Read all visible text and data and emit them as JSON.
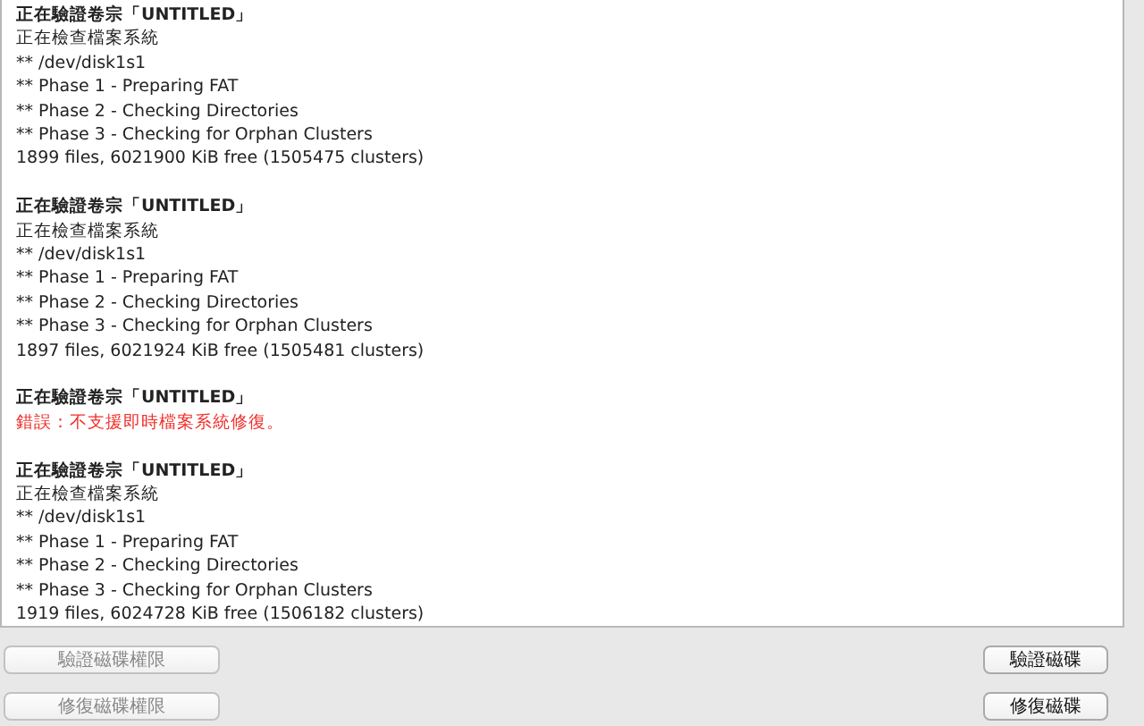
{
  "log": [
    {
      "lines": [
        {
          "kind": "heading",
          "text": "正在驗證卷宗「UNTITLED」"
        },
        {
          "kind": "normal",
          "text": "正在檢查檔案系統"
        },
        {
          "kind": "normal",
          "text": "** /dev/disk1s1"
        },
        {
          "kind": "normal",
          "text": "** Phase 1 - Preparing FAT"
        },
        {
          "kind": "normal",
          "text": "** Phase 2 - Checking Directories"
        },
        {
          "kind": "normal",
          "text": "** Phase 3 - Checking for Orphan Clusters"
        },
        {
          "kind": "normal",
          "text": "1899 files, 6021900 KiB free (1505475 clusters)"
        }
      ]
    },
    {
      "lines": [
        {
          "kind": "heading",
          "text": "正在驗證卷宗「UNTITLED」"
        },
        {
          "kind": "normal",
          "text": "正在檢查檔案系統"
        },
        {
          "kind": "normal",
          "text": "** /dev/disk1s1"
        },
        {
          "kind": "normal",
          "text": "** Phase 1 - Preparing FAT"
        },
        {
          "kind": "normal",
          "text": "** Phase 2 - Checking Directories"
        },
        {
          "kind": "normal",
          "text": "** Phase 3 - Checking for Orphan Clusters"
        },
        {
          "kind": "normal",
          "text": "1897 files, 6021924 KiB free (1505481 clusters)"
        }
      ]
    },
    {
      "lines": [
        {
          "kind": "heading",
          "text": "正在驗證卷宗「UNTITLED」"
        },
        {
          "kind": "error",
          "text": "錯誤：不支援即時檔案系統修復。"
        }
      ]
    },
    {
      "lines": [
        {
          "kind": "heading",
          "text": "正在驗證卷宗「UNTITLED」"
        },
        {
          "kind": "normal",
          "text": "正在檢查檔案系統"
        },
        {
          "kind": "normal",
          "text": "** /dev/disk1s1"
        },
        {
          "kind": "normal",
          "text": "** Phase 1 - Preparing FAT"
        },
        {
          "kind": "normal",
          "text": "** Phase 2 - Checking Directories"
        },
        {
          "kind": "normal",
          "text": "** Phase 3 - Checking for Orphan Clusters"
        },
        {
          "kind": "normal",
          "text": "1919 files, 6024728 KiB free (1506182 clusters)"
        }
      ]
    }
  ],
  "button_rows": [
    {
      "left_button": {
        "label": "驗證磁碟權限",
        "disabled": true
      },
      "right_button": {
        "label": "驗證磁碟",
        "disabled": false
      }
    },
    {
      "left_button": {
        "label": "修復磁碟權限",
        "disabled": true
      },
      "right_button": {
        "label": "修復磁碟",
        "disabled": false
      }
    }
  ]
}
